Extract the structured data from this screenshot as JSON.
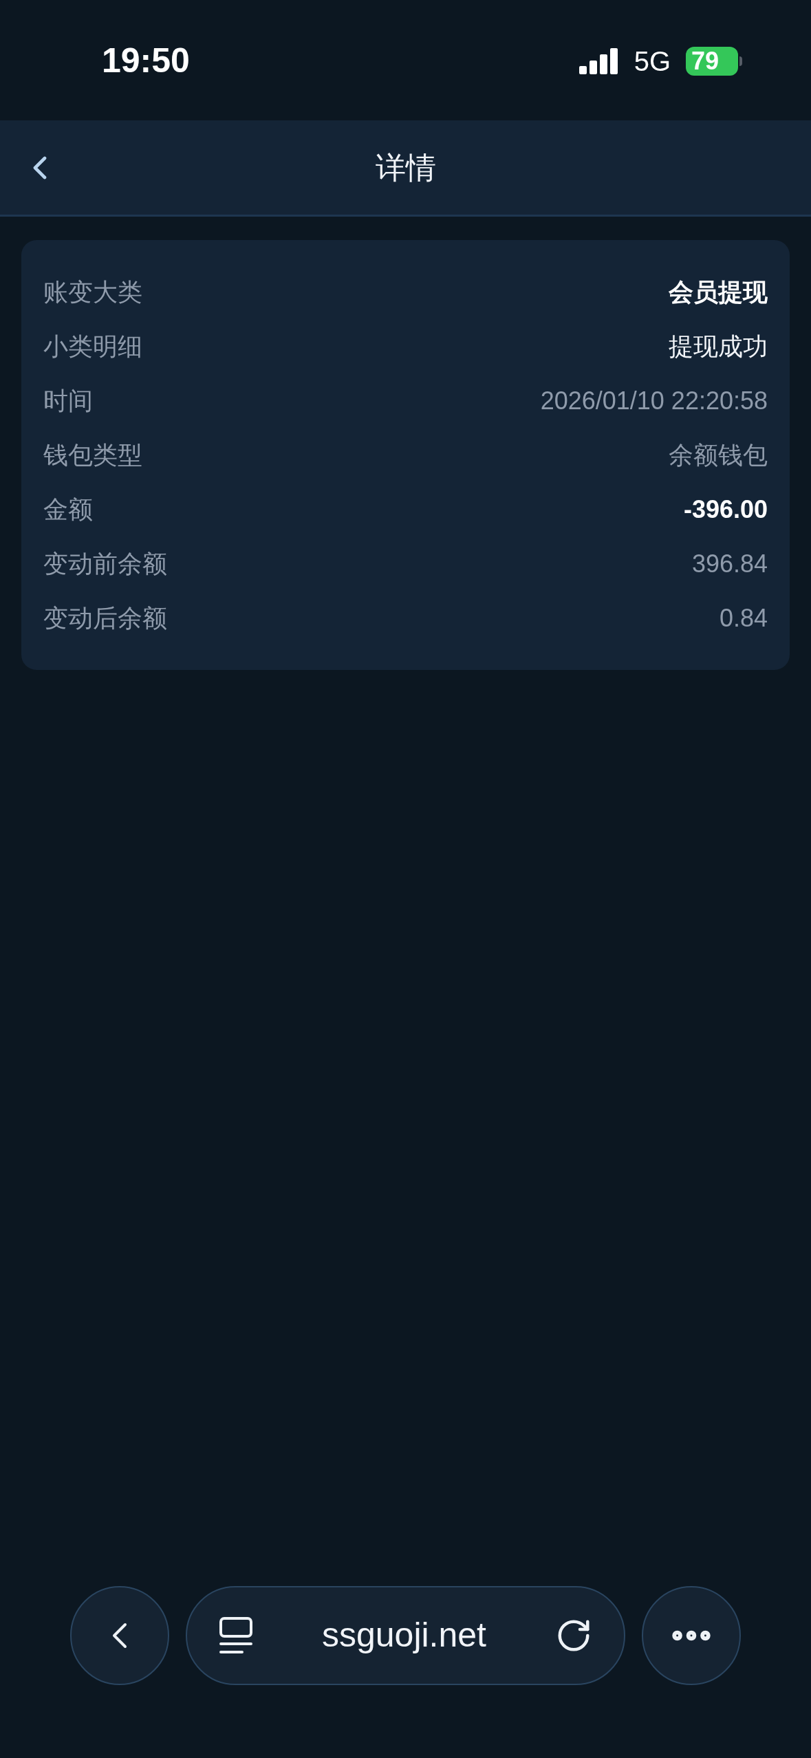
{
  "status_bar": {
    "time": "19:50",
    "network": "5G",
    "battery": "79"
  },
  "header": {
    "title": "详情"
  },
  "details": [
    {
      "label": "账变大类",
      "value": "会员提现",
      "kind": "strong"
    },
    {
      "label": "小类明细",
      "value": "提现成功",
      "kind": "normal"
    },
    {
      "label": "时间",
      "value": "2026/01/10 22:20:58",
      "kind": "muted"
    },
    {
      "label": "钱包类型",
      "value": "余额钱包",
      "kind": "muted"
    },
    {
      "label": "金额",
      "value": "-396.00",
      "kind": "strong"
    },
    {
      "label": "变动前余额",
      "value": "396.84",
      "kind": "muted"
    },
    {
      "label": "变动后余额",
      "value": "0.84",
      "kind": "muted"
    }
  ],
  "browser_bar": {
    "url": "ssguoji.net"
  }
}
